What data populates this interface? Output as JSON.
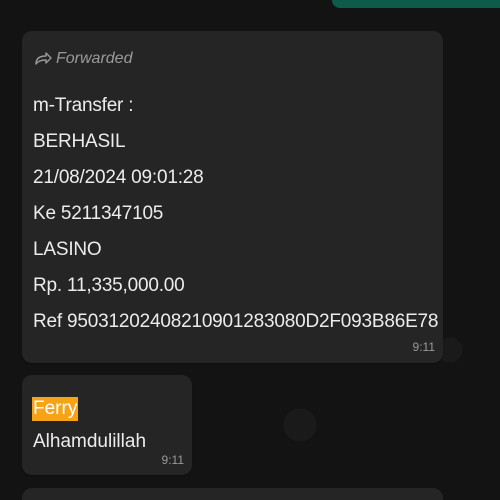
{
  "messages": [
    {
      "forwarded_label": "Forwarded",
      "lines": [
        "m-Transfer :",
        "BERHASIL",
        "21/08/2024 09:01:28",
        "Ke 5211347105",
        "LASINO",
        "Rp. 11,335,000.00",
        "Ref 95031202408210901283080D2F093B86E78"
      ],
      "time": "9:11"
    },
    {
      "sender": "Ferry",
      "text": "Alhamdulillah",
      "time": "9:11"
    }
  ],
  "colors": {
    "bubble_incoming": "#252525",
    "bubble_outgoing": "#0d5c4b",
    "sender_highlight": "#f6a318",
    "background": "#131313"
  }
}
